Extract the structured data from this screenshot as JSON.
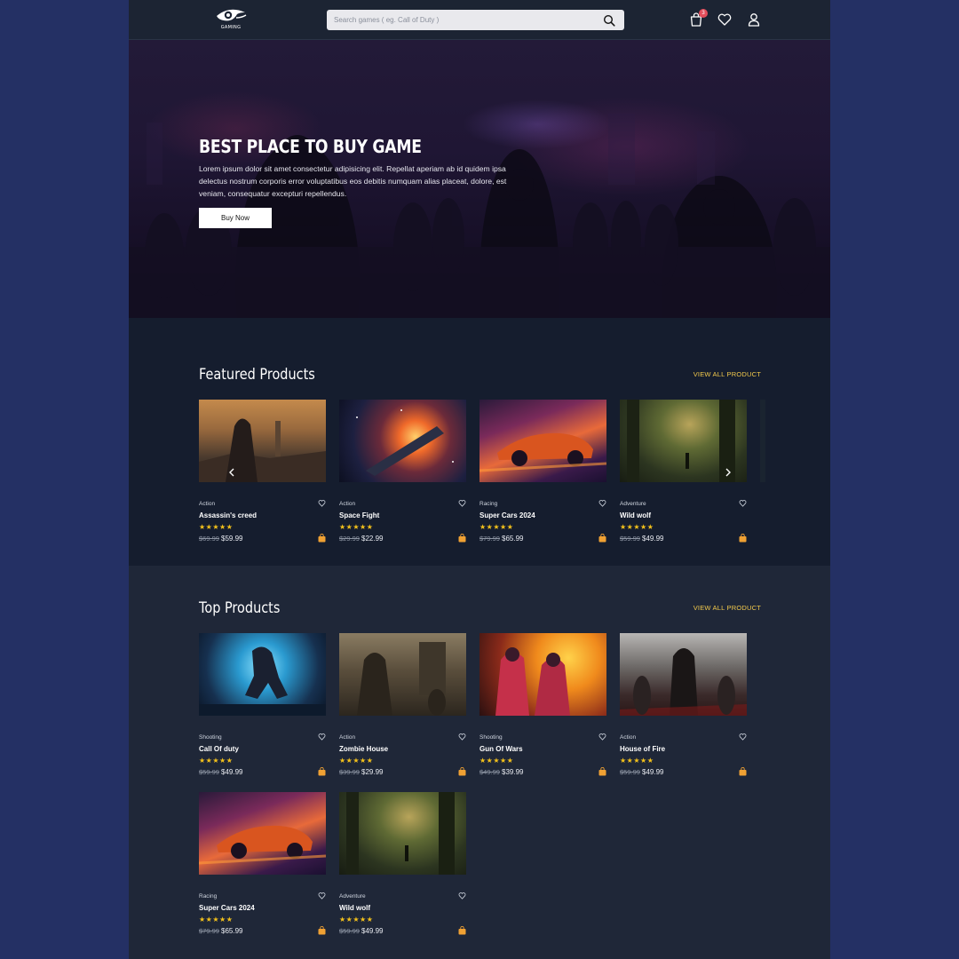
{
  "header": {
    "logo_text": "GAMING",
    "search_placeholder": "Search games ( eg. Call of Duty )",
    "cart_count": "3"
  },
  "hero": {
    "title": "BEST PLACE TO BUY GAME",
    "text": "Lorem ipsum dolor sit amet consectetur adipisicing elit. Repellat aperiam ab id quidem ipsa delectus nostrum corporis error voluptatibus eos debitis numquam alias placeat, dolore, est veniam, consequatur excepturi repellendus.",
    "button": "Buy Now"
  },
  "featured": {
    "title": "Featured Products",
    "view_all": "VIEW ALL PRODUCT",
    "items": [
      {
        "category": "Action",
        "name": "Assassin's creed",
        "rating": 5,
        "old_price": "$69.99",
        "price": "$59.99"
      },
      {
        "category": "Action",
        "name": "Space Fight",
        "rating": 5,
        "old_price": "$29.99",
        "price": "$22.99"
      },
      {
        "category": "Racing",
        "name": "Super Cars 2024",
        "rating": 5,
        "old_price": "$79.99",
        "price": "$65.99"
      },
      {
        "category": "Adventure",
        "name": "Wild wolf",
        "rating": 5,
        "old_price": "$59.99",
        "price": "$49.99"
      }
    ]
  },
  "top": {
    "title": "Top Products",
    "view_all": "VIEW ALL PRODUCT",
    "items": [
      {
        "category": "Shooting",
        "name": "Call Of duty",
        "rating": 5,
        "old_price": "$59.99",
        "price": "$49.99"
      },
      {
        "category": "Action",
        "name": "Zombie House",
        "rating": 5,
        "old_price": "$39.99",
        "price": "$29.99"
      },
      {
        "category": "Shooting",
        "name": "Gun Of Wars",
        "rating": 5,
        "old_price": "$49.99",
        "price": "$39.99"
      },
      {
        "category": "Action",
        "name": "House of Fire",
        "rating": 5,
        "old_price": "$59.99",
        "price": "$49.99"
      },
      {
        "category": "Racing",
        "name": "Super Cars 2024",
        "rating": 5,
        "old_price": "$79.99",
        "price": "$65.99"
      },
      {
        "category": "Adventure",
        "name": "Wild wolf",
        "rating": 5,
        "old_price": "$59.99",
        "price": "$49.99"
      }
    ]
  },
  "icons": {
    "search": "search-icon",
    "cart": "cart-icon",
    "wishlist": "heart-icon",
    "account": "user-icon",
    "prev": "chevron-left-icon",
    "next": "chevron-right-icon",
    "add_to_cart": "shopping-bag-icon"
  },
  "colors": {
    "accent": "#f2c94c",
    "star": "#f4c21b",
    "bag": "#f0a133",
    "badge": "#e34d5b",
    "page_bg": "#243064"
  }
}
